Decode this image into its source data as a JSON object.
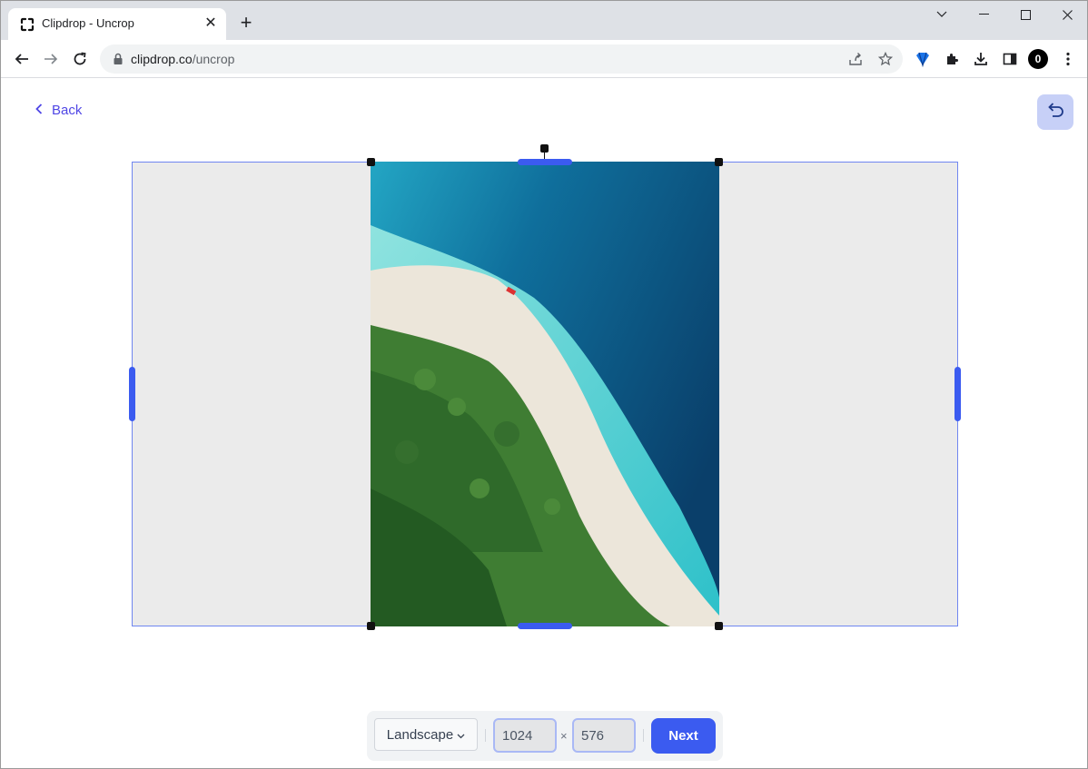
{
  "browser": {
    "tab_title": "Clipdrop - Uncrop",
    "tab_close": "✕",
    "new_tab": "+",
    "url_domain": "clipdrop.co",
    "url_path": "/uncrop",
    "profile_initial": "0"
  },
  "page": {
    "back_label": "Back",
    "controls": {
      "preset_label": "Landscape",
      "width_value": "1024",
      "height_value": "576",
      "times_symbol": "×",
      "next_label": "Next"
    }
  },
  "colors": {
    "accent": "#3b5bf0",
    "link": "#4f46e5",
    "canvas_bg": "#ebebeb",
    "undo_bg": "#c7d0f7"
  },
  "icons": {
    "favicon": "clipdrop-icon",
    "back": "chevron-left-icon",
    "undo": "undo-icon",
    "share": "share-icon",
    "star": "star-icon",
    "extension": "puzzle-icon",
    "download": "download-icon",
    "sidepanel": "sidepanel-icon",
    "menu": "kebab-menu-icon"
  }
}
